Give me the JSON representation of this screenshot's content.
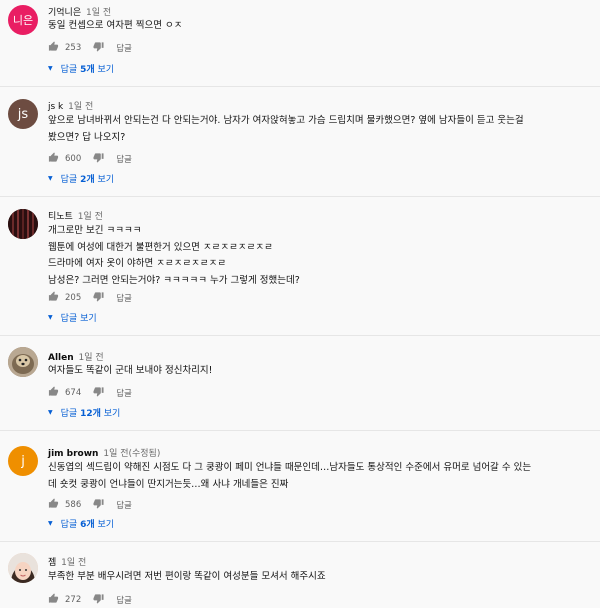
{
  "ui": {
    "reply_label": "답글",
    "view_replies_prefix": "답글",
    "view_replies_suffix": "보기"
  },
  "comments": [
    {
      "author": "기억니은",
      "time": "1일 전",
      "avatar_text": "니은",
      "avatar_color": "#e91e63",
      "lines": [
        "동일 컨셉으로 여자편 찍으면 ㅇㅈ"
      ],
      "likes": "253",
      "replies_count": "5개"
    },
    {
      "author": "js k",
      "time": "1일 전",
      "avatar_text": "js",
      "avatar_color": "#6d4c41",
      "lines": [
        "앞으로 남녀바뀌서 안되는건 다 안되는거야. 남자가 여자앉혀놓고 가슴 드립치며 물카했으면? 옆에 남자들이 듣고 웃는걸",
        "봤으면? 답 나오지?"
      ],
      "likes": "600",
      "replies_count": "2개"
    },
    {
      "author": "티노트",
      "time": "1일 전",
      "avatar_text": "",
      "avatar_color": "#3a1a1a",
      "lines": [
        "개그로만 보긴 ㅋㅋㅋㅋ",
        "웹툰에 여성에 대한거 불편한거 있으면 ㅈㄹㅈㄹㅈㄹㅈㄹ",
        "드라마에 여자 옷이 야하면 ㅈㄹㅈㄹㅈㄹㅈㄹ",
        "남성은? 그러면 안되는거야? ㅋㅋㅋㅋㅋ 누가 그렇게 정했는데?"
      ],
      "likes": "205",
      "replies_count": ""
    },
    {
      "author": "Allen",
      "time": "1일 전",
      "avatar_text": "",
      "avatar_color": "#8d7b6a",
      "lines": [
        "여자들도 똑같이 군대 보내야 정신차리지!"
      ],
      "likes": "674",
      "replies_count": "12개"
    },
    {
      "author": "jim brown",
      "time": "1일 전(수정됨)",
      "avatar_text": "j",
      "avatar_color": "#ef8f00",
      "lines": [
        "신동엽의 섹드립이 약해진 시점도 다 그 쿵쾅이 페미 언냐들 때문인데…남자들도 통상적인 수준에서 유머로 넘어갈 수 있는",
        "데 숏컷 쿵쾅이 언냐들이 딴지거는듯…왜 사냐 개네들은 진짜"
      ],
      "likes": "586",
      "replies_count": "6개"
    },
    {
      "author": "젬",
      "time": "1일 전",
      "avatar_text": "",
      "avatar_color": "#f1c9b5",
      "lines": [
        "부족한 부분 배우시려면 저번 편이랑 똑같이 여성분들 모셔서 해주시죠"
      ],
      "likes": "272",
      "replies_count": ""
    }
  ]
}
